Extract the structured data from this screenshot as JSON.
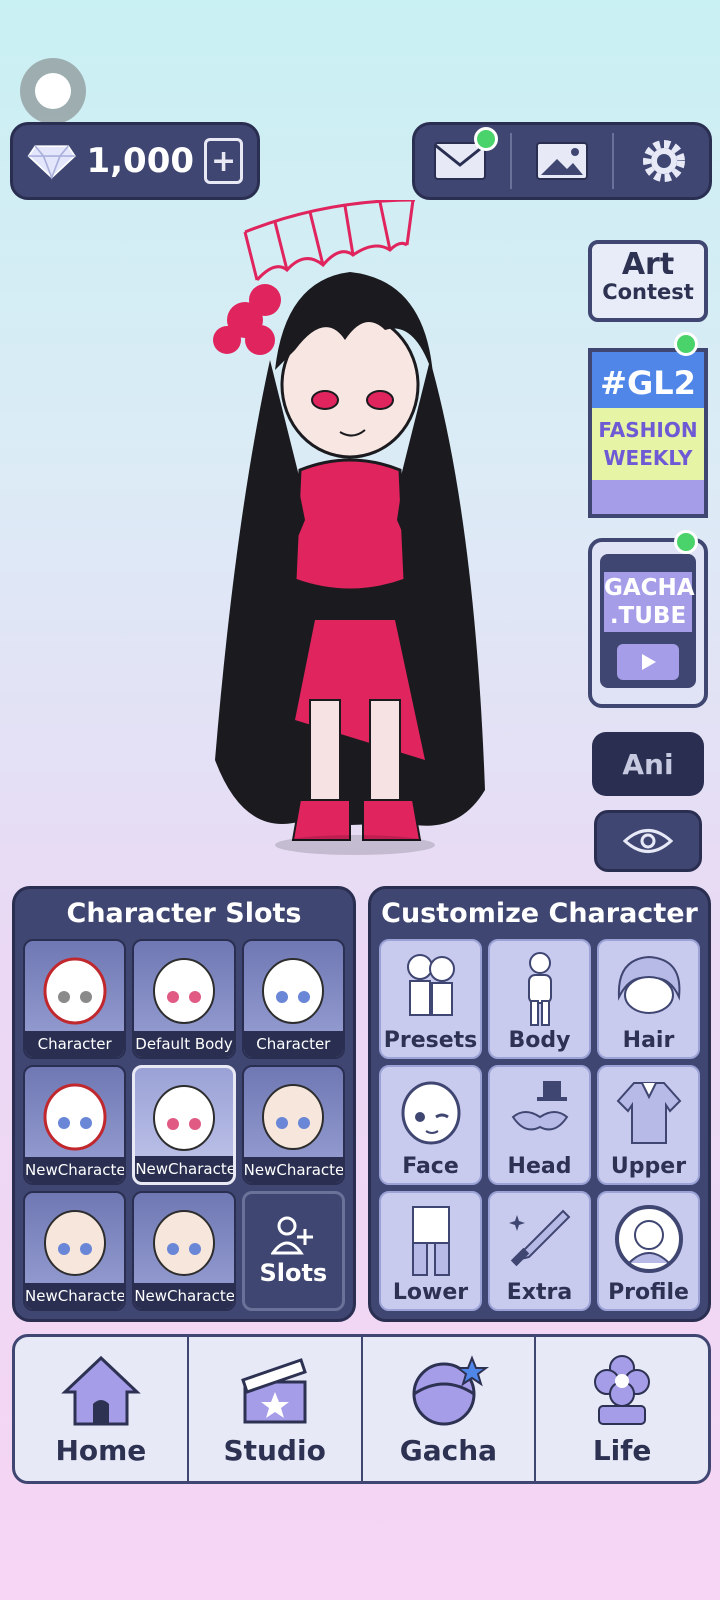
{
  "currency": {
    "amount": "1,000",
    "icon": "diamond-icon",
    "add_icon": "film-plus-icon"
  },
  "top_right": {
    "buttons": [
      "mail-icon",
      "gallery-icon",
      "settings-icon"
    ]
  },
  "side": {
    "art_contest": {
      "line1": "Art",
      "line2": "Contest"
    },
    "fashion": {
      "tag": "#GL2",
      "line1": "FASHION",
      "line2": "WEEKLY"
    },
    "tube": {
      "line1": "GACHA",
      "line2": ".TUBE"
    },
    "ani": "Ani"
  },
  "slots_panel": {
    "title": "Character Slots",
    "slots": [
      {
        "label": "Character",
        "eye": "#8a8a8a",
        "outline": "#c0282e"
      },
      {
        "label": "Default Body",
        "eye": "#e05a84",
        "outline": "#2d2d2d"
      },
      {
        "label": "Character",
        "eye": "#6a86d6",
        "outline": "#2d2d2d"
      },
      {
        "label": "NewCharacter",
        "eye": "#6a86d6",
        "outline": "#c0282e"
      },
      {
        "label": "NewCharacter",
        "eye": "#e05a84",
        "outline": "#2d2d2d"
      },
      {
        "label": "NewCharacter",
        "eye": "#6a86d6",
        "outline": "#2d2d2d"
      },
      {
        "label": "NewCharacter",
        "eye": "#6a86d6",
        "outline": "#2d2d2d"
      },
      {
        "label": "NewCharacter",
        "eye": "#6a86d6",
        "outline": "#2d2d2d"
      }
    ],
    "add_label": "Slots"
  },
  "customize_panel": {
    "title": "Customize Character",
    "items": [
      "Presets",
      "Body",
      "Hair",
      "Face",
      "Head",
      "Upper",
      "Lower",
      "Extra",
      "Profile"
    ]
  },
  "nav": [
    "Home",
    "Studio",
    "Gacha",
    "Life"
  ],
  "colors": {
    "panel": "#3f4672",
    "accent_pink": "#e0245e",
    "notification": "#4bd36b"
  }
}
